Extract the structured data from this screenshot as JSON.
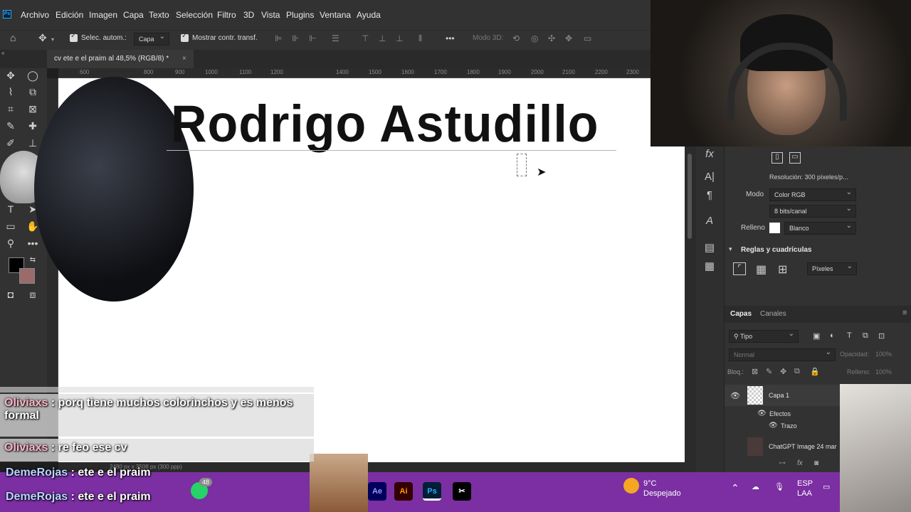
{
  "app": {
    "logo": "Ps",
    "menu": [
      "Archivo",
      "Edición",
      "Imagen",
      "Capa",
      "Texto",
      "Selección",
      "Filtro",
      "3D",
      "Vista",
      "Plugins",
      "Ventana",
      "Ayuda"
    ]
  },
  "options_bar": {
    "auto_select_label": "Selec. autom.:",
    "auto_select_value": "Capa",
    "transform_label": "Mostrar contr. transf.",
    "mode_3d": "Modo 3D:"
  },
  "document_tab": {
    "title": "cv ete e el praim al 48,5% (RGB/8) *",
    "close": "×"
  },
  "ruler_ticks": [
    "600",
    "800",
    "900",
    "1000",
    "1100",
    "1200",
    "1400",
    "1500",
    "1600",
    "1700",
    "1800",
    "1900",
    "2000",
    "2100",
    "2200",
    "2300"
  ],
  "canvas": {
    "heading": "Rodrigo Astudillo"
  },
  "status": {
    "zoom": "48,48%",
    "dimensions": "2480 px x 3508 px (300 ppp)"
  },
  "properties": {
    "resolution": "Resolución: 300 píxeles/p...",
    "mode_label": "Modo",
    "mode_value": "Color RGB",
    "bits_value": "8 bits/canal",
    "fill_label": "Relleno",
    "fill_value": "Blanco",
    "rulers_title": "Reglas y cuadrículas",
    "units_value": "Píxeles"
  },
  "layers": {
    "tab_layers": "Capas",
    "tab_channels": "Canales",
    "filter_label": "Tipo",
    "blend": "Normal",
    "opacity_label": "Opacidad:",
    "opacity_value": "100%",
    "lock_label": "Bloq.:",
    "fill_label": "Relleno:",
    "fill_value": "100%",
    "items": [
      {
        "name": "Capa 1"
      },
      {
        "name": "Efectos"
      },
      {
        "name": "Trazo"
      },
      {
        "name": "ChatGPT Image 24 mar"
      }
    ]
  },
  "chat": [
    {
      "user": "Oliviaxs",
      "message": " : porq tiene muchos colorinchos y es menos formal"
    },
    {
      "user": "Oliviaxs",
      "message": " : re feo ese cv"
    },
    {
      "user": "DemeRojas",
      "message": " : ete e el praim"
    },
    {
      "user": "DemeRojas",
      "message": " : ete e el praim"
    }
  ],
  "taskbar": {
    "apps": [
      "Ae",
      "Ai",
      "Ps"
    ],
    "weather_temp": "9°C",
    "weather_desc": "Despejado",
    "lang_top": "ESP",
    "lang_bottom": "LAA",
    "whatsapp_badge": "48"
  },
  "colors": {
    "accent_ps": "#31a8ff",
    "taskbar": "#7b2fa2",
    "panel": "#323232"
  }
}
